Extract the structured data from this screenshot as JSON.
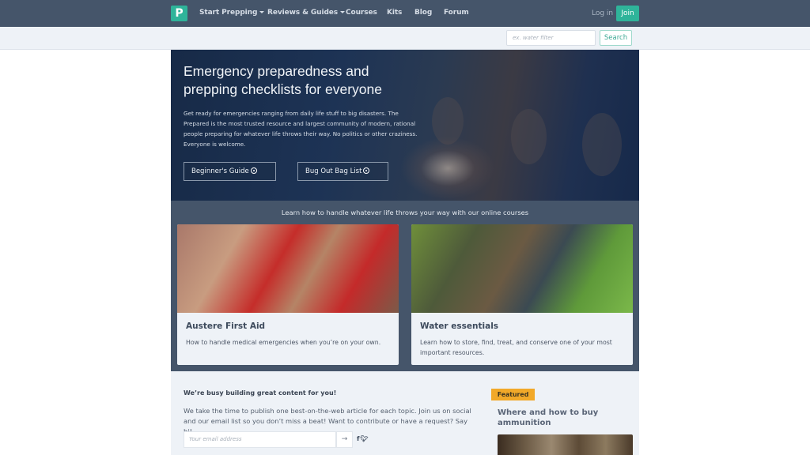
{
  "nav": {
    "logo": "P",
    "items": [
      {
        "label": "Start Prepping",
        "dropdown": true
      },
      {
        "label": "Reviews & Guides",
        "dropdown": true
      },
      {
        "label": "Courses",
        "dropdown": false
      },
      {
        "label": "Kits",
        "dropdown": false
      },
      {
        "label": "Blog",
        "dropdown": false
      },
      {
        "label": "Forum",
        "dropdown": false
      }
    ],
    "login": "Log in",
    "join": "Join"
  },
  "search": {
    "placeholder": "ex. water filter",
    "button": "Search"
  },
  "hero": {
    "title": "Emergency preparedness and prepping checklists for everyone",
    "description": "Get ready for emergencies ranging from daily life stuff to big disasters. The Prepared is the most trusted resource and largest community of modern, rational people preparing for whatever life throws their way. No politics or other craziness. Everyone is welcome.",
    "buttons": [
      "Beginner's Guide",
      "Bug Out Bag List"
    ]
  },
  "courses": {
    "title": "Learn how to handle whatever life throws your way with our online courses",
    "cards": [
      {
        "title": "Austere First Aid",
        "description": "How to handle medical emergencies when you’re on your own."
      },
      {
        "title": "Water essentials",
        "description": "Learn how to store, find, treat, and conserve one of your most important resources."
      }
    ]
  },
  "newsletter": {
    "heading": "We’re busy building great content for you!",
    "body": "We take the time to publish one best-on-the-web article for each topic. Join us on social and our email list so you don’t miss a beat! Want to contribute or have a request? Say hi!",
    "email_placeholder": "Your email address",
    "submit": "→",
    "social": "f🐦"
  },
  "featured": {
    "badge": "Featured",
    "title": "Where and how to buy ammunition"
  },
  "colors": {
    "nav_bg": "#45556a",
    "accent": "#2fb49a",
    "featured_badge": "#f2a929"
  }
}
